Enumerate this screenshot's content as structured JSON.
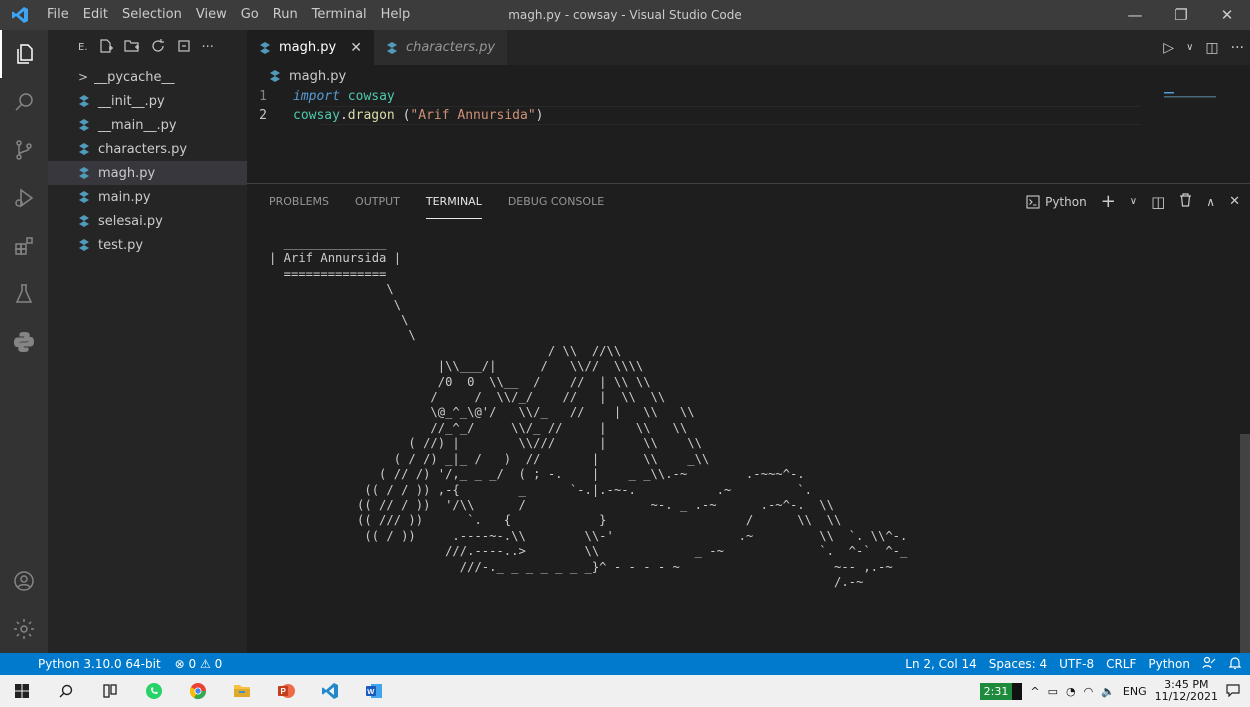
{
  "titlebar": {
    "menu": [
      "File",
      "Edit",
      "Selection",
      "View",
      "Go",
      "Run",
      "Terminal",
      "Help"
    ],
    "title": "magh.py - cowsay - Visual Studio Code",
    "minimize": "—",
    "maximize": "❐",
    "close": "✕"
  },
  "sidebar": {
    "header_label": "E.",
    "files": [
      {
        "name": "__pycache__",
        "type": "folder"
      },
      {
        "name": "__init__.py",
        "type": "py"
      },
      {
        "name": "__main__.py",
        "type": "py"
      },
      {
        "name": "characters.py",
        "type": "py"
      },
      {
        "name": "magh.py",
        "type": "py"
      },
      {
        "name": "main.py",
        "type": "py"
      },
      {
        "name": "selesai.py",
        "type": "py"
      },
      {
        "name": "test.py",
        "type": "py"
      }
    ],
    "selected": "magh.py"
  },
  "editor": {
    "tabs": [
      {
        "label": "magh.py",
        "active": true
      },
      {
        "label": "characters.py",
        "active": false
      }
    ],
    "tab_close": "✕",
    "breadcrumb": "magh.py",
    "lines": [
      {
        "num": "1",
        "keyword": "import",
        "module": "cowsay"
      },
      {
        "num": "2",
        "module": "cowsay",
        "dot": ".",
        "func": "dragon",
        "open": " (",
        "string": "\"Arif Annursida\"",
        "close": ")"
      }
    ]
  },
  "panel": {
    "tabs": [
      "PROBLEMS",
      "OUTPUT",
      "TERMINAL",
      "DEBUG CONSOLE"
    ],
    "active_tab": "TERMINAL",
    "terminal_label": "Python",
    "terminal_output": "  ______________\n| Arif Annursida |\n  ==============\n                \\\n                 \\\n                  \\\n                   \\\n                                      / \\\\  //\\\\\n                       |\\\\___/|      /   \\\\//  \\\\\\\\\n                       /0  0  \\\\__  /    //  | \\\\ \\\\\n                      /     /  \\\\/_/    //   |  \\\\  \\\\\n                      \\@_^_\\@'/   \\\\/_   //    |   \\\\   \\\\\n                      //_^_/     \\\\/_ //     |    \\\\   \\\\\n                   ( //) |        \\\\///      |     \\\\    \\\\\n                 ( / /) _|_ /   )  //       |      \\\\    _\\\\\n               ( // /) '/,_ _ _/  ( ; -.    |    _ _\\\\.-~        .-~~~^-.\n             (( / / )) ,-{        _      `-.|.-~-.           .~         `.\n            (( // / ))  '/\\\\      /                 ~-. _ .-~      .-~^-.  \\\\\n            (( /// ))      `.   {            }                   /      \\\\  \\\\\n             (( / ))     .----~-.\\\\        \\\\-'                 .~         \\\\  `. \\\\^-.\n                        ///.----..>        \\\\             _ -~             `.  ^-`  ^-_\n                          ///-._ _ _ _ _ _ _}^ - - - - ~                     ~-- ,.-~\n                                                                             /.-~"
  },
  "statusbar": {
    "interpreter": "Python 3.10.0 64-bit",
    "errors": "⊗ 0",
    "warnings": "⚠ 0",
    "position": "Ln 2, Col 14",
    "spaces": "Spaces: 4",
    "encoding": "UTF-8",
    "eol": "CRLF",
    "language": "Python"
  },
  "taskbar": {
    "badge": "2:31",
    "lang": "ENG",
    "time": "3:45 PM",
    "date": "11/12/2021"
  },
  "colors": {
    "accent": "#007acc",
    "python_blue": "#519aba"
  }
}
